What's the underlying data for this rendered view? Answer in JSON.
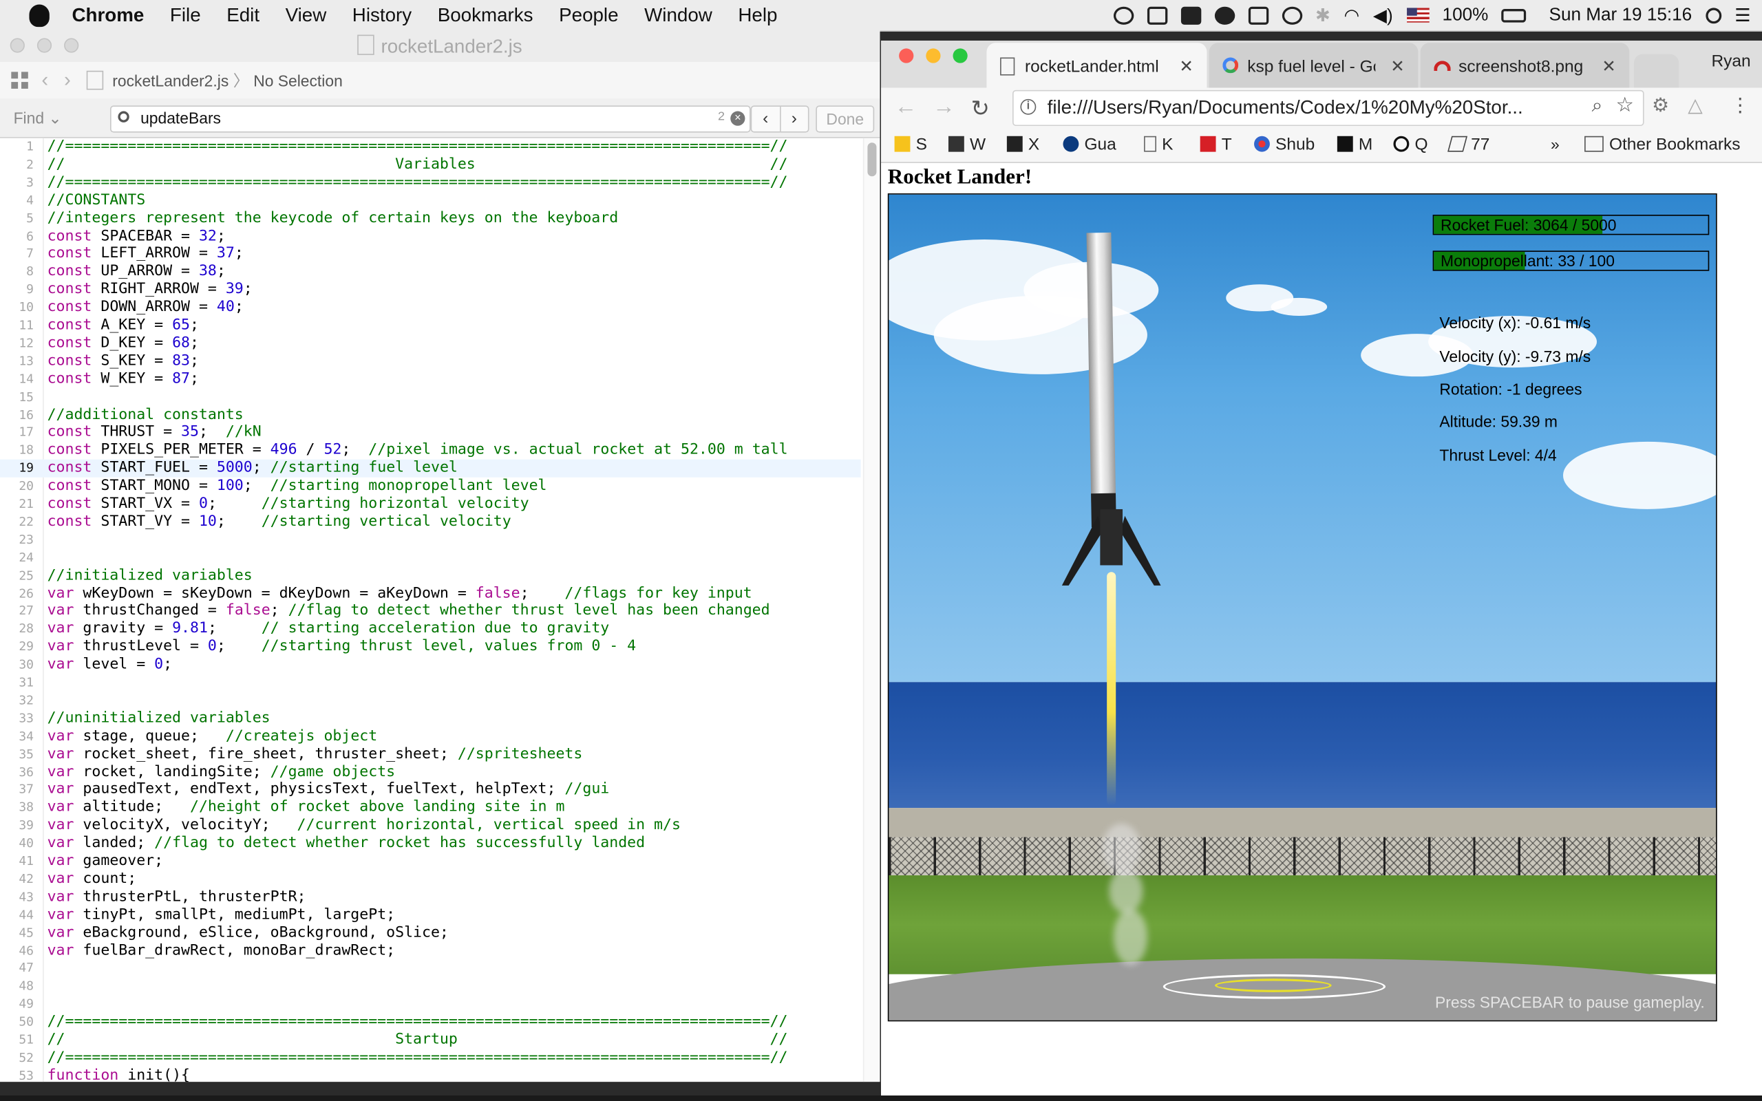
{
  "menubar": {
    "app": "Chrome",
    "items": [
      "File",
      "Edit",
      "View",
      "History",
      "Bookmarks",
      "People",
      "Window",
      "Help"
    ],
    "battery": "100%",
    "clock": "Sun Mar 19  15:16"
  },
  "xcode": {
    "window_title": "rocketLander2.js",
    "breadcrumb_file": "rocketLander2.js",
    "breadcrumb_sep": "〉",
    "breadcrumb_selection": "No Selection",
    "find_label": "Find ⌄",
    "find_query": "updateBars",
    "find_count": "2",
    "done_label": "Done",
    "current_line": 19,
    "lines": [
      "//===============================================================================//",
      "//                                     Variables                                 //",
      "//===============================================================================//",
      "//CONSTANTS",
      "//integers represent the keycode of certain keys on the keyboard",
      "const SPACEBAR = 32;",
      "const LEFT_ARROW = 37;",
      "const UP_ARROW = 38;",
      "const RIGHT_ARROW = 39;",
      "const DOWN_ARROW = 40;",
      "const A_KEY = 65;",
      "const D_KEY = 68;",
      "const S_KEY = 83;",
      "const W_KEY = 87;",
      "",
      "//additional constants",
      "const THRUST = 35;  //kN",
      "const PIXELS_PER_METER = 496 / 52;  //pixel image vs. actual rocket at 52.00 m tall",
      "const START_FUEL = 5000; //starting fuel level",
      "const START_MONO = 100;  //starting monopropellant level",
      "const START_VX = 0;     //starting horizontal velocity",
      "const START_VY = 10;    //starting vertical velocity",
      "",
      "",
      "//initialized variables",
      "var wKeyDown = sKeyDown = dKeyDown = aKeyDown = false;    //flags for key input",
      "var thrustChanged = false; //flag to detect whether thrust level has been changed",
      "var gravity = 9.81;     // starting acceleration due to gravity",
      "var thrustLevel = 0;    //starting thrust level, values from 0 - 4",
      "var level = 0;",
      "",
      "",
      "//uninitialized variables",
      "var stage, queue;   //createjs object",
      "var rocket_sheet, fire_sheet, thruster_sheet; //spritesheets",
      "var rocket, landingSite; //game objects",
      "var pausedText, endText, physicsText, fuelText, helpText; //gui",
      "var altitude;   //height of rocket above landing site in m",
      "var velocityX, velocityY;   //current horizontal, vertical speed in m/s",
      "var landed; //flag to detect whether rocket has successfully landed",
      "var gameover;",
      "var count;",
      "var thrusterPtL, thrusterPtR;",
      "var tinyPt, smallPt, mediumPt, largePt;",
      "var eBackground, eSlice, oBackground, oSlice;",
      "var fuelBar_drawRect, monoBar_drawRect;",
      "",
      "",
      "",
      "//===============================================================================//",
      "//                                     Startup                                   //",
      "//===============================================================================//",
      "function init(){"
    ]
  },
  "chrome": {
    "profile": "Ryan",
    "tabs": [
      {
        "label": "rocketLander.html",
        "active": true
      },
      {
        "label": "ksp fuel level - Go",
        "active": false
      },
      {
        "label": "screenshot8.png",
        "active": false
      }
    ],
    "url": "file:///Users/Ryan/Documents/Codex/1%20My%20Stor...",
    "bookmarks": [
      {
        "label": "S",
        "icon": "sg-icon"
      },
      {
        "label": "W",
        "icon": "w-icon"
      },
      {
        "label": "X",
        "icon": "x-icon"
      },
      {
        "label": "Gua",
        "icon": "guardian-icon"
      },
      {
        "label": "K",
        "icon": "doc-icon"
      },
      {
        "label": "T",
        "icon": "t-icon"
      },
      {
        "label": "Shub",
        "icon": "shub-icon"
      },
      {
        "label": "M",
        "icon": "m-icon"
      },
      {
        "label": "Q",
        "icon": "q-icon"
      },
      {
        "label": "77",
        "icon": "77-icon"
      }
    ],
    "overflow": "»",
    "other_bookmarks": "Other Bookmarks"
  },
  "game": {
    "heading": "Rocket Lander!",
    "fuel_label": "Rocket Fuel: 3064 / 5000",
    "fuel_fraction": 0.6128,
    "mono_label": "Monopropellant: 33 / 100",
    "mono_fraction": 0.33,
    "velocity_x": "Velocity (x): -0.61 m/s",
    "velocity_y": "Velocity (y): -9.73 m/s",
    "rotation": "Rotation: -1 degrees",
    "altitude": "Altitude: 59.39 m",
    "thrust": "Thrust Level: 4/4",
    "pause_hint": "Press SPACEBAR to pause gameplay."
  },
  "colors": {
    "keyword": "#aa0d91",
    "number": "#1c00cf",
    "comment": "#007400",
    "bar_fill": "#0b7d0b"
  }
}
